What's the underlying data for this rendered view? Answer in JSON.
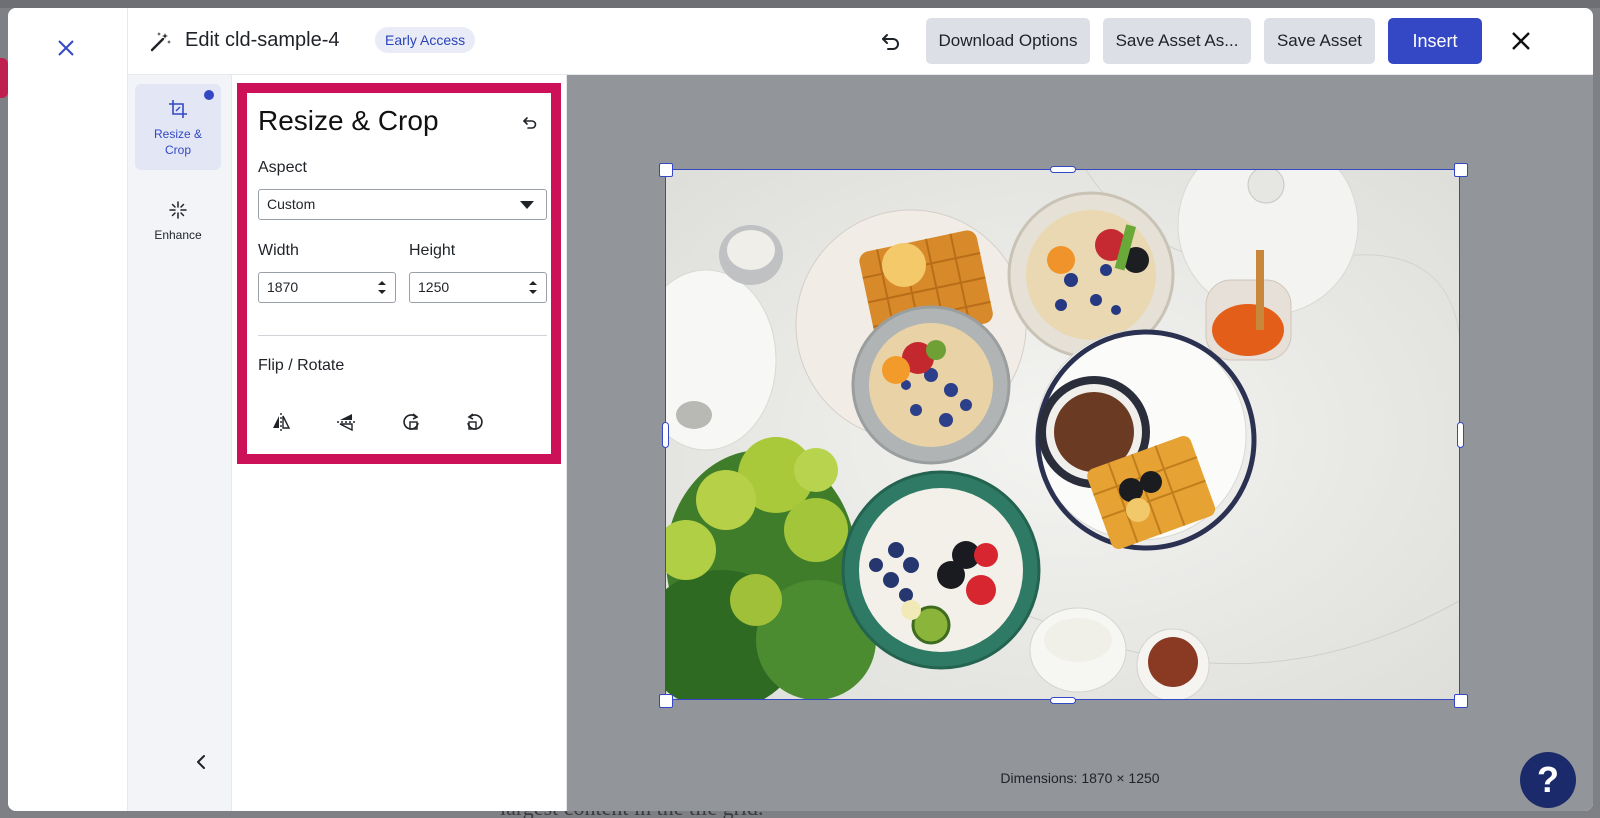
{
  "editor": {
    "title": "Edit cld-sample-4",
    "badge": "Early Access"
  },
  "toolbar": {
    "download_label": "Download Options",
    "save_as_label": "Save Asset As...",
    "save_label": "Save Asset",
    "insert_label": "Insert"
  },
  "tools": [
    {
      "label": "Resize & Crop",
      "icon": "crop-icon",
      "active": true
    },
    {
      "label": "Enhance",
      "icon": "sparkle-icon",
      "active": false
    }
  ],
  "panel": {
    "title": "Resize & Crop",
    "aspect_label": "Aspect",
    "aspect_value": "Custom",
    "width_label": "Width",
    "width_value": "1870",
    "height_label": "Height",
    "height_value": "1250",
    "flip_label": "Flip / Rotate",
    "flip_actions": [
      "flip-horizontal-icon",
      "flip-vertical-icon",
      "rotate-right-icon",
      "rotate-left-icon"
    ]
  },
  "canvas": {
    "dimensions": "Dimensions: 1870 × 1250"
  },
  "backdrop": {
    "text": "largest content in the tile grid."
  },
  "colors": {
    "primary": "#3448c5",
    "highlight_box": "#cc1158",
    "badge_bg": "#e9ecf6"
  }
}
